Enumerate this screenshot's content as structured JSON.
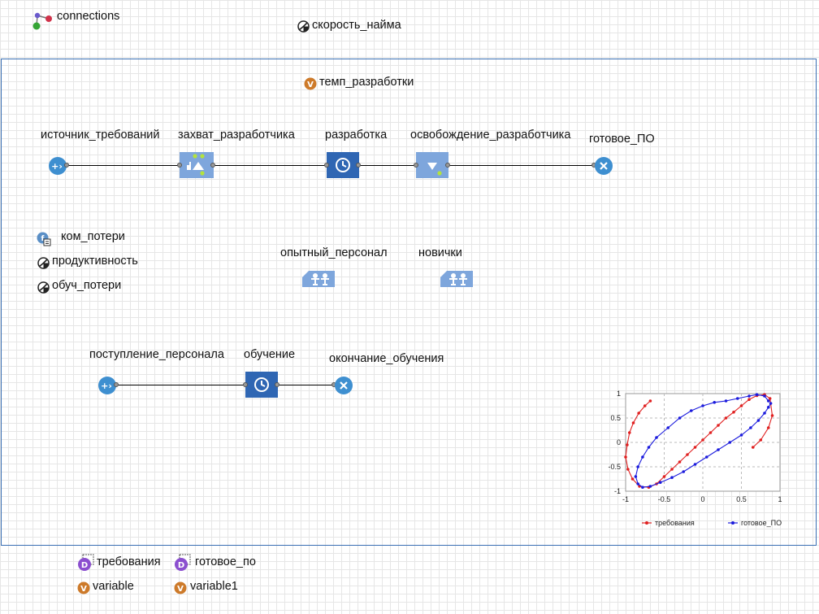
{
  "top": {
    "connections_label": "connections",
    "hire_rate_label": "скорость_найма"
  },
  "frame": {
    "dev_rate_label": "темп_разработки",
    "nodes": {
      "source": "источник_требований",
      "seize": "захват_разработчика",
      "delay": "разработка",
      "release": "освобождение_разработчика",
      "sink": "готовое_ПО",
      "source2": "поступление_персонала",
      "delay2": "обучение",
      "sink2": "окончание_обучения"
    },
    "params": {
      "com_loss": "ком_потери",
      "productivity": "продуктивность",
      "train_loss": "обуч_потери"
    },
    "pools": {
      "experienced": "опытный_персонал",
      "novices": "новички"
    }
  },
  "bottom": {
    "dataset1": "требования",
    "dataset2": "готовое_по",
    "var1": "variable",
    "var2": "variable1"
  },
  "colors": {
    "node_blue": "#3e8fd0",
    "block_dark": "#2f66b3",
    "block_light": "#7ea6dc",
    "frame": "#3a6fb3",
    "series_red": "#e02020",
    "series_blue": "#1b1bdd",
    "var_orange": "#cd7a2a",
    "dataset_purple": "#8b4fcf"
  },
  "chart_data": {
    "type": "scatter",
    "xlim": [
      -1,
      1
    ],
    "ylim": [
      -1,
      1
    ],
    "xticks": [
      "-1",
      "-0.5",
      "0",
      "0.5",
      "1"
    ],
    "yticks": [
      "1",
      "0.5",
      "0",
      "-0.5",
      "-1"
    ],
    "grid": true,
    "legend_position": "bottom",
    "series": [
      {
        "name": "требования",
        "color": "#e02020",
        "x": [
          -0.68,
          -0.75,
          -0.83,
          -0.9,
          -0.95,
          -0.98,
          -1.0,
          -0.97,
          -0.91,
          -0.82,
          -0.7,
          -0.6,
          -0.5,
          -0.4,
          -0.3,
          -0.2,
          -0.1,
          0.0,
          0.1,
          0.2,
          0.3,
          0.4,
          0.5,
          0.6,
          0.7,
          0.8,
          0.87,
          0.9,
          0.85,
          0.75,
          0.65
        ],
        "y": [
          0.85,
          0.75,
          0.6,
          0.4,
          0.2,
          -0.05,
          -0.3,
          -0.55,
          -0.75,
          -0.9,
          -0.92,
          -0.85,
          -0.7,
          -0.55,
          -0.4,
          -0.25,
          -0.1,
          0.05,
          0.2,
          0.35,
          0.5,
          0.62,
          0.75,
          0.88,
          0.96,
          0.98,
          0.9,
          0.55,
          0.3,
          0.05,
          -0.1
        ]
      },
      {
        "name": "готовое_ПО",
        "color": "#1b1bdd",
        "x": [
          0.85,
          0.8,
          0.7,
          0.6,
          0.45,
          0.3,
          0.15,
          0.0,
          -0.15,
          -0.3,
          -0.45,
          -0.6,
          -0.7,
          -0.78,
          -0.84,
          -0.87,
          -0.84,
          -0.78,
          -0.68,
          -0.55,
          -0.4,
          -0.25,
          -0.1,
          0.05,
          0.2,
          0.35,
          0.5,
          0.62,
          0.72,
          0.8,
          0.85,
          0.88
        ],
        "y": [
          0.85,
          0.95,
          0.98,
          0.95,
          0.9,
          0.85,
          0.82,
          0.75,
          0.65,
          0.5,
          0.3,
          0.1,
          -0.1,
          -0.3,
          -0.5,
          -0.7,
          -0.85,
          -0.92,
          -0.9,
          -0.82,
          -0.72,
          -0.6,
          -0.45,
          -0.3,
          -0.15,
          0.0,
          0.15,
          0.3,
          0.45,
          0.6,
          0.72,
          0.8
        ]
      }
    ]
  }
}
